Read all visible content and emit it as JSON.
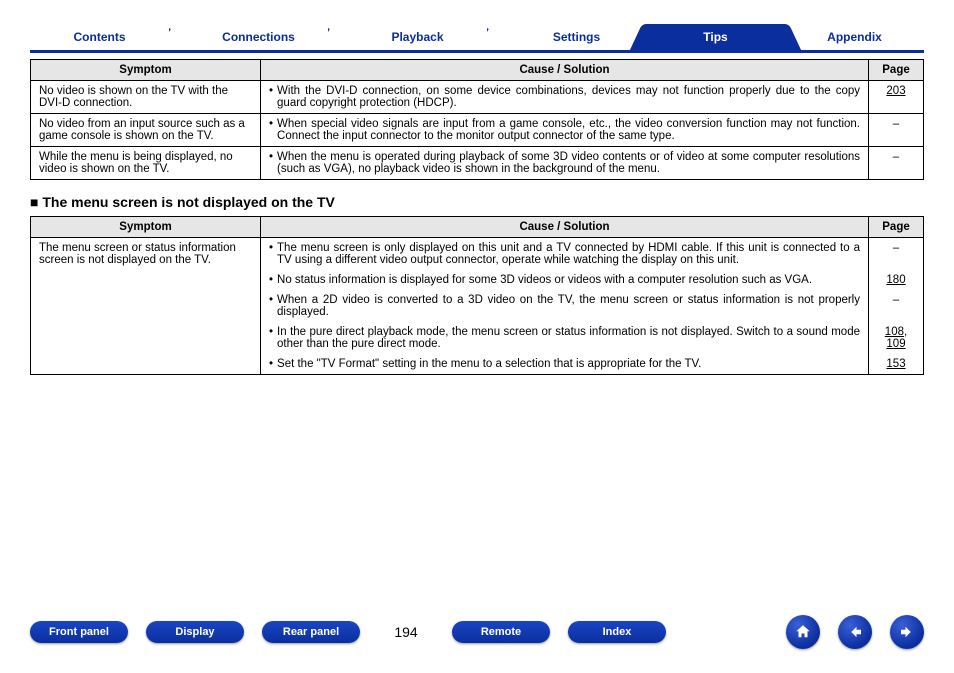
{
  "tabs": {
    "contents": "Contents",
    "connections": "Connections",
    "playback": "Playback",
    "settings": "Settings",
    "tips": "Tips",
    "appendix": "Appendix"
  },
  "headers": {
    "symptom": "Symptom",
    "cause": "Cause / Solution",
    "page": "Page"
  },
  "table1": {
    "rows": [
      {
        "symptom": "No video is shown on the TV with the DVI-D connection.",
        "solution": "With the DVI-D connection, on some device combinations, devices may not function properly due to the copy guard copyright protection (HDCP).",
        "page": "203",
        "pageLink": true
      },
      {
        "symptom": "No video from an input source such as a game console is shown on the TV.",
        "solution": "When special video signals are input from a game console, etc., the video conversion function may not function. Connect the input connector to the monitor output connector of the same type.",
        "page": "–",
        "pageLink": false
      },
      {
        "symptom": "While the menu is being displayed, no video is shown on the TV.",
        "solution": "When the menu is operated during playback of some 3D video contents or of video at some computer resolutions (such as VGA), no playback video is shown in the background of the menu.",
        "page": "–",
        "pageLink": false
      }
    ]
  },
  "section2": {
    "title": "The menu screen is not displayed on the TV",
    "symptom": "The menu screen or status information screen is not displayed on the TV.",
    "items": [
      {
        "solution": "The menu screen is only displayed on this unit and a TV connected by HDMI cable. If this unit is connected to a TV using a different video output connector, operate while watching the display on this unit.",
        "page": "–",
        "links": []
      },
      {
        "solution": "No status information is displayed for some 3D videos or videos with a computer resolution such as VGA.",
        "page": "180",
        "links": [
          "180"
        ]
      },
      {
        "solution": "When a 2D video is converted to a 3D video on the TV, the menu screen or status information is not properly displayed.",
        "page": "–",
        "links": []
      },
      {
        "solution": "In the pure direct playback mode, the menu screen or status information is not displayed. Switch to a sound mode other than the pure direct mode.",
        "page": "108, 109",
        "links": [
          "108",
          "109"
        ]
      },
      {
        "solution": "Set the \"TV Format\" setting in the menu to a selection that is appropriate for the TV.",
        "page": "153",
        "links": [
          "153"
        ]
      }
    ]
  },
  "bottom": {
    "frontPanel": "Front panel",
    "display": "Display",
    "rearPanel": "Rear panel",
    "pageNumber": "194",
    "remote": "Remote",
    "index": "Index"
  }
}
